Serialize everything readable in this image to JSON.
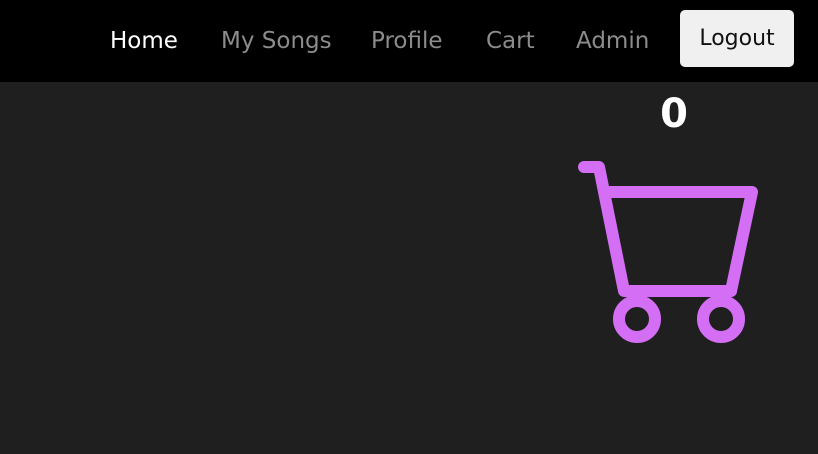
{
  "nav": {
    "items": [
      {
        "label": "Home",
        "active": true
      },
      {
        "label": "My Songs",
        "active": false
      },
      {
        "label": "Profile",
        "active": false
      },
      {
        "label": "Cart",
        "active": false
      },
      {
        "label": "Admin",
        "active": false
      }
    ],
    "logout_label": "Logout"
  },
  "cart": {
    "count": "0",
    "icon": "shopping-cart-icon",
    "icon_color": "#d46ef5"
  },
  "colors": {
    "navbar_bg": "#000000",
    "page_bg": "#1f1f1f",
    "nav_active": "#ffffff",
    "nav_inactive": "#8c8c8c",
    "accent": "#d46ef5"
  }
}
